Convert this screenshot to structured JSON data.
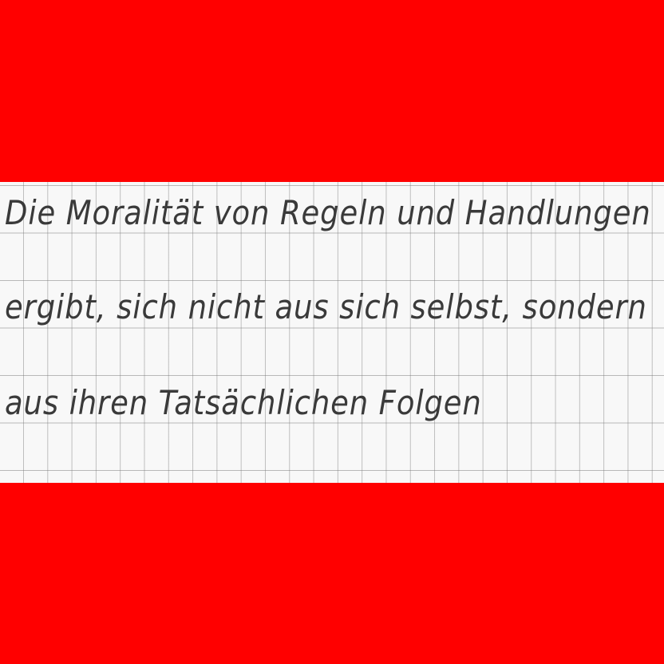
{
  "handwriting": {
    "lines": [
      "Die Moralität von Regeln und Handlungen",
      "ergibt, sich nicht aus sich selbst, sondern",
      "aus ihren Tatsächlichen Folgen"
    ]
  },
  "colors": {
    "band": "#ff0000",
    "paper": "#f8f8f8",
    "ink": "#3a3a3a"
  }
}
